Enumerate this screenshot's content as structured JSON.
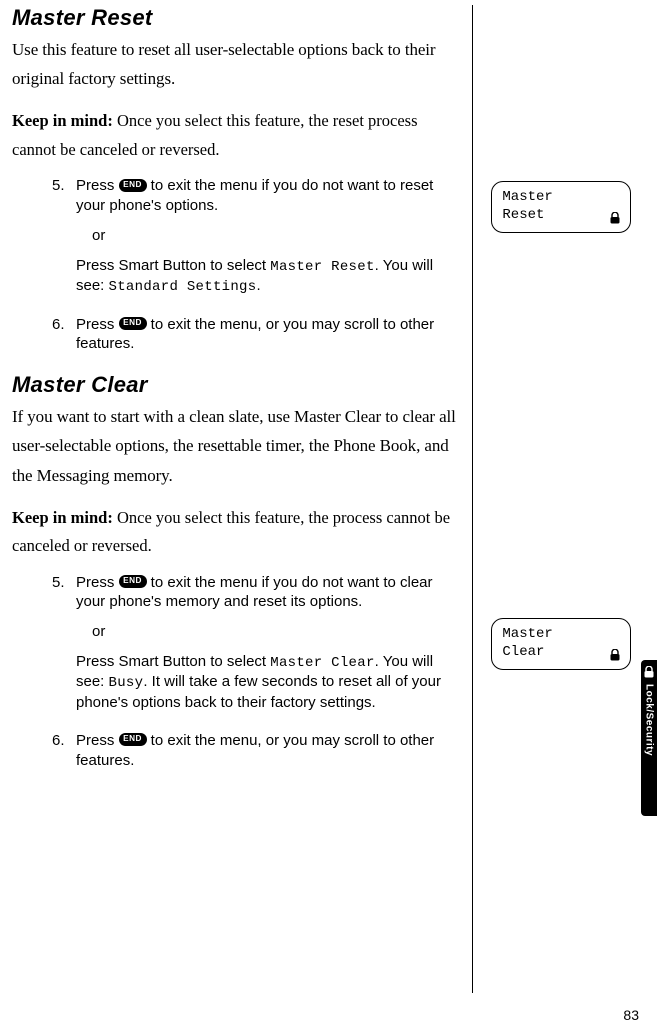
{
  "sections": {
    "reset": {
      "heading": "Master Reset",
      "intro": "Use this feature to reset all user-selectable options back to their original factory settings.",
      "kim_label": "Keep in mind:",
      "kim_text": " Once you select this feature, the reset process cannot be canceled or reversed.",
      "step5_num": "5.",
      "step5a_pre": "Press ",
      "end_label": "END",
      "step5a_post": " to exit the menu if you do not want to reset your phone's options.",
      "or": "or",
      "step5b_pre": "Press Smart Button to select ",
      "step5b_code": "Master Reset",
      "step5b_mid": ". You will see: ",
      "step5b_code2": "Standard Settings",
      "step5b_post": ".",
      "step6_num": "6.",
      "step6_pre": "Press ",
      "step6_post": " to exit the menu, or you may scroll to other features."
    },
    "clear": {
      "heading": "Master Clear",
      "intro": "If you want to start with a clean slate, use Master Clear to clear all user-selectable options, the resettable timer, the Phone Book, and the Messaging memory.",
      "kim_label": "Keep in mind:",
      "kim_text": " Once you select this feature, the process cannot be canceled or reversed.",
      "step5_num": "5.",
      "step5a_pre": "Press ",
      "step5a_post": " to exit the menu if you do not want to clear your phone's memory and reset its options.",
      "or": "or",
      "step5b_pre": "Press Smart Button to select ",
      "step5b_code": "Master Clear",
      "step5b_mid": ". You will see: ",
      "step5b_code2": "Busy",
      "step5b_post": ". It will take a few seconds to reset all of your phone's options back to their factory settings.",
      "step6_num": "6.",
      "step6_pre": "Press ",
      "step6_post": " to exit the menu, or you may scroll to other features."
    }
  },
  "screens": {
    "s1_line1": "Master",
    "s1_line2": "Reset",
    "s2_line1": "Master",
    "s2_line2": "Clear"
  },
  "tab": {
    "label": "Lock/Security"
  },
  "page_number": "83"
}
